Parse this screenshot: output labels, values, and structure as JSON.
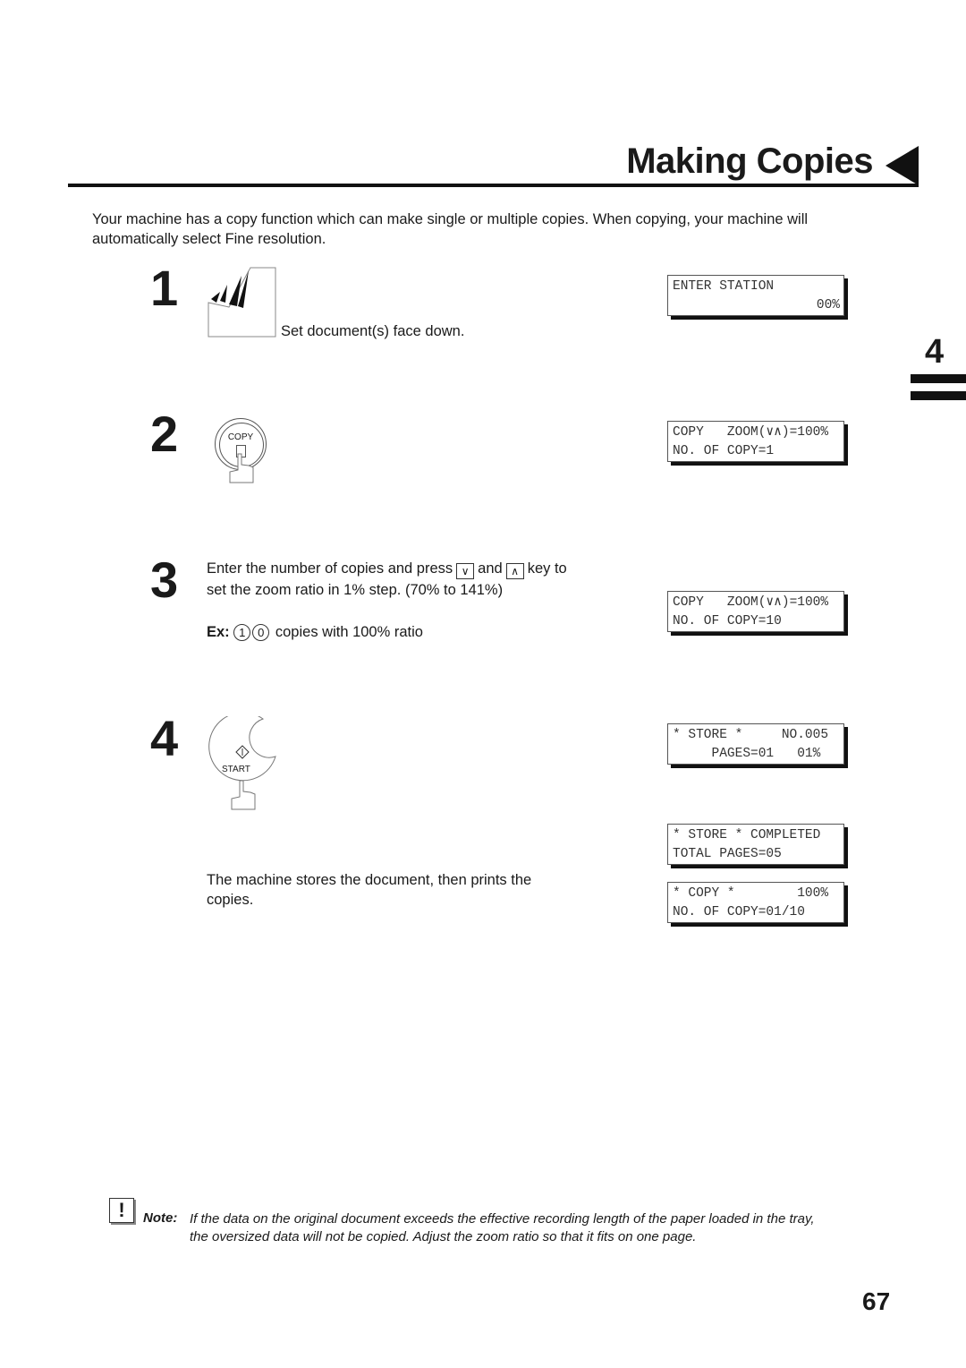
{
  "header": {
    "title": "Making Copies",
    "chapter_tab": "4"
  },
  "intro": "Your machine has a copy function which can make single or multiple copies. When copying, your machine will automatically select Fine resolution.",
  "steps": [
    {
      "number": "1",
      "text": "Set document(s) face down.",
      "lcd": [
        "ENTER STATION",
        "00%"
      ]
    },
    {
      "number": "2",
      "button_label": "COPY",
      "lcd": [
        "COPY   ZOOM(∨∧)=100%",
        "NO. OF COPY=1"
      ]
    },
    {
      "number": "3",
      "text_a": "Enter the number of copies and press",
      "key_down": "∨",
      "text_and": "and",
      "key_up": "∧",
      "text_b": "key to",
      "text_line2": "set the zoom ratio in 1% step. (70% to 141%)",
      "ex_label": "Ex:",
      "ex_keys": [
        "1",
        "0"
      ],
      "ex_text": "copies with 100% ratio",
      "lcd": [
        "COPY   ZOOM(∨∧)=100%",
        "NO. OF COPY=10"
      ]
    },
    {
      "number": "4",
      "button_label": "START",
      "lcd": [
        "* STORE *     NO.005",
        "     PAGES=01   01%"
      ],
      "lcd2": [
        "* STORE * COMPLETED",
        "TOTAL PAGES=05"
      ],
      "lcd3": [
        "* COPY *        100%",
        "NO. OF COPY=01/10"
      ],
      "text_line1": "The machine stores the document, then prints the",
      "text_line2": "copies."
    }
  ],
  "note": {
    "icon": "!",
    "label": "Note:",
    "line1": "If the data on the original document exceeds the effective recording length of the paper loaded in the tray,",
    "line2": "the oversized data will not be copied.  Adjust the zoom ratio so that it fits on one page."
  },
  "page_number": "67"
}
